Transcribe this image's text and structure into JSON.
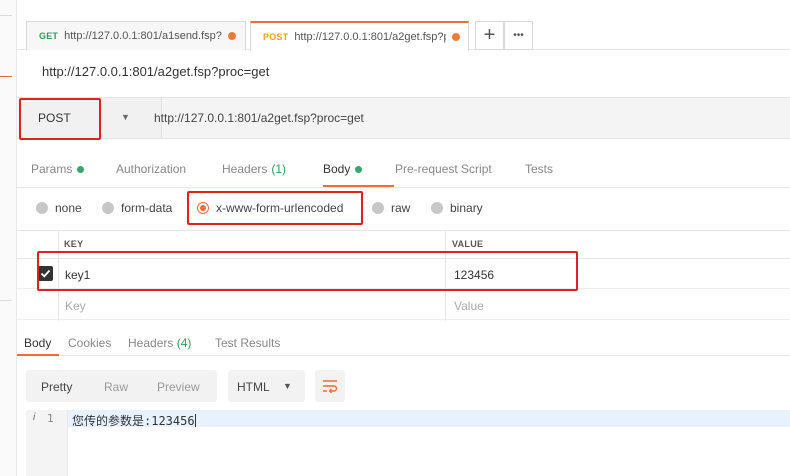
{
  "tabs": [
    {
      "method": "GET",
      "url": "http://127.0.0.1:801/a1send.fsp?",
      "active": false
    },
    {
      "method": "POST",
      "url": "http://127.0.0.1:801/a2get.fsp?p",
      "active": true
    }
  ],
  "tab_actions": {
    "new_tab": "+",
    "more": "•••"
  },
  "request": {
    "title": "http://127.0.0.1:801/a2get.fsp?proc=get",
    "method": "POST",
    "url": "http://127.0.0.1:801/a2get.fsp?proc=get"
  },
  "request_tabs": {
    "params": "Params",
    "authorization": "Authorization",
    "headers": "Headers",
    "headers_count": "(1)",
    "body": "Body",
    "prerequest": "Pre-request Script",
    "tests": "Tests"
  },
  "body_types": {
    "none": "none",
    "form_data": "form-data",
    "urlencoded": "x-www-form-urlencoded",
    "raw": "raw",
    "binary": "binary",
    "selected": "x-www-form-urlencoded"
  },
  "kv_table": {
    "key_header": "KEY",
    "value_header": "VALUE",
    "rows": [
      {
        "key": "key1",
        "value": "123456",
        "checked": true
      }
    ],
    "placeholder": {
      "key": "Key",
      "value": "Value"
    }
  },
  "response_tabs": {
    "body": "Body",
    "cookies": "Cookies",
    "headers": "Headers",
    "headers_count": "(4)",
    "test_results": "Test Results"
  },
  "view_modes": {
    "pretty": "Pretty",
    "raw": "Raw",
    "preview": "Preview"
  },
  "format": "HTML",
  "editor": {
    "line_info": "i",
    "line_number": "1",
    "content": "您传的参数是:123456"
  },
  "colors": {
    "accent": "#f26b3a",
    "highlight_box": "#e0221e",
    "success": "#2d9c5b"
  }
}
